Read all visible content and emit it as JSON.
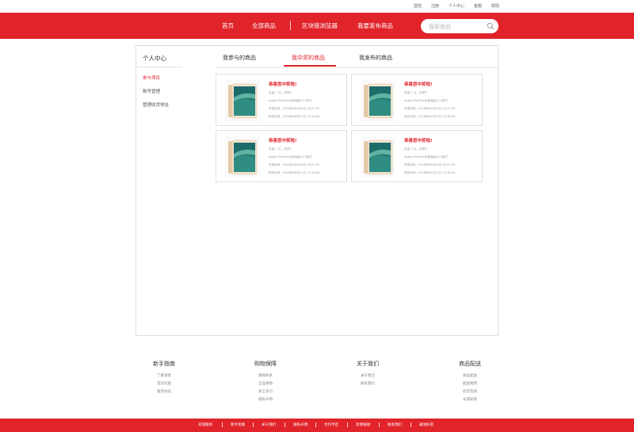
{
  "topbar": {
    "links": [
      "登陆",
      "注册",
      "个人中心",
      "客服",
      "帮助"
    ]
  },
  "nav": {
    "items": [
      "首页",
      "全部商品",
      "区块链浏览器",
      "我要发布商品"
    ]
  },
  "search": {
    "placeholder": "搜索商品"
  },
  "sidebar": {
    "title": "个人中心",
    "items": [
      {
        "label": "参与项目",
        "active": true
      },
      {
        "label": "账号管理",
        "active": false
      },
      {
        "label": "管理收货地址",
        "active": false
      }
    ]
  },
  "tabs": [
    {
      "label": "我参与的商品",
      "active": false
    },
    {
      "label": "我中奖的商品",
      "active": true
    },
    {
      "label": "我发布的商品",
      "active": false
    }
  ],
  "cards": [
    {
      "title": "恭喜您中奖啦!",
      "l1": "总量 1 元，共得了",
      "l2": "Apple iPad Pro平板电脑12.9英寸",
      "l3": "开奖时间：2018年09月05日 16:27:39",
      "l4": "购买时间：2018年09月21日 13:16:50"
    },
    {
      "title": "恭喜您中奖啦!",
      "l1": "总量 1 元，共得了",
      "l2": "Apple iPad Pro平板电脑12.9英寸",
      "l3": "开奖时间：2018年09月05日 16:27:39",
      "l4": "购买时间：2018年09月21日 13:16:50"
    },
    {
      "title": "恭喜您中奖啦!",
      "l1": "总量 1 元，共得了",
      "l2": "Apple iPad Pro平板电脑12.9英寸",
      "l3": "开奖时间：2018年09月05日 16:27:39",
      "l4": "购买时间：2018年09月21日 13:16:50"
    },
    {
      "title": "恭喜您中奖啦!",
      "l1": "总量 1 元，共得了",
      "l2": "Apple iPad Pro平板电脑12.9英寸",
      "l3": "开奖时间：2018年09月05日 16:27:39",
      "l4": "购买时间：2018年09月21日 13:16:50"
    }
  ],
  "footer": {
    "columns": [
      {
        "heading": "新手指南",
        "links": [
          "了解须债",
          "常见问题",
          "服务协议"
        ]
      },
      {
        "heading": "购物保障",
        "links": [
          "保障体系",
          "正品保障",
          "安全支付",
          "隐私声明"
        ]
      },
      {
        "heading": "关于我们",
        "links": [
          "关于我们",
          "联系我们"
        ]
      },
      {
        "heading": "商品配送",
        "links": [
          "商品配送",
          "配送费用",
          "验货签收",
          "长期安排"
        ]
      }
    ]
  },
  "bottombar": {
    "links": [
      "充值服务",
      "新手指南",
      "关于我们",
      "隐私声明",
      "合作专区",
      "友情链接",
      "联系我们",
      "邀请好友"
    ]
  },
  "colors": {
    "brand": "#e1232a"
  }
}
